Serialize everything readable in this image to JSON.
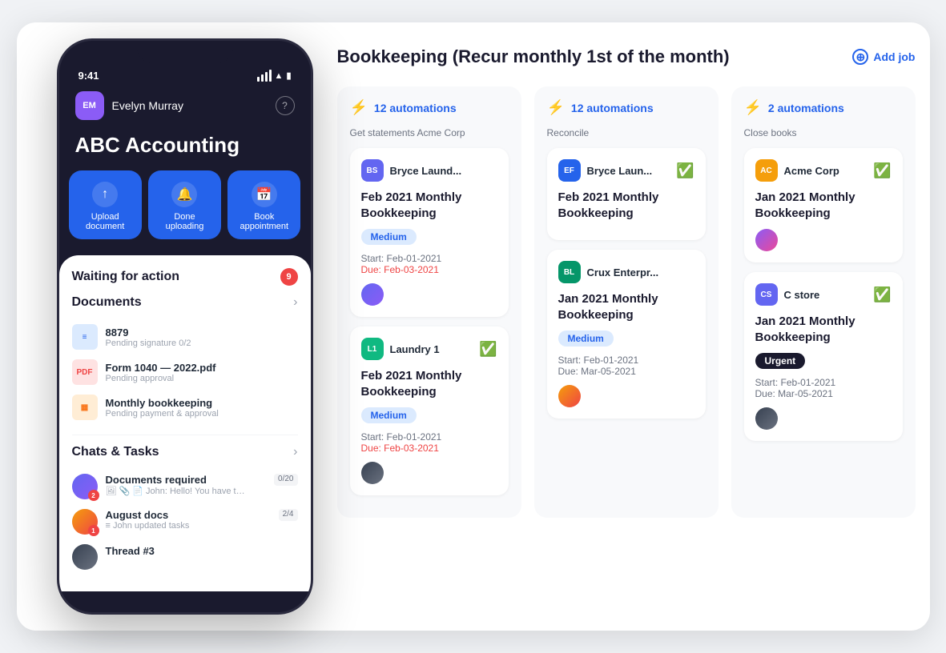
{
  "app": {
    "bg_color": "#f0f2f5"
  },
  "page": {
    "title": "Bookkeeping (Recur monthly 1st of the month)",
    "add_job_label": "Add job"
  },
  "phone": {
    "status_bar": {
      "time": "9:41"
    },
    "header": {
      "user_initials": "EM",
      "user_name": "Evelyn Murray",
      "company": "ABC Accounting"
    },
    "actions": [
      {
        "label": "Upload\ndocument",
        "icon": "↑"
      },
      {
        "label": "Done\nuploading",
        "icon": "🔔"
      },
      {
        "label": "Book\nappointment",
        "icon": "📅"
      }
    ],
    "waiting_for_action": {
      "title": "Waiting for action",
      "badge": "9"
    },
    "documents": {
      "section_title": "Documents",
      "items": [
        {
          "name": "8879",
          "sub": "Pending signature 0/2",
          "type": "doc"
        },
        {
          "name": "Form 1040 — 2022.pdf",
          "sub": "Pending approval",
          "type": "pdf"
        },
        {
          "name": "Monthly bookkeeping",
          "sub": "Pending payment & approval",
          "type": "ppt"
        }
      ]
    },
    "chats": {
      "section_title": "Chats & Tasks",
      "items": [
        {
          "title": "Documents required",
          "sub": "John: Hello! You have to read...",
          "count": "0/20",
          "badge": "2"
        },
        {
          "title": "August docs",
          "sub": "John updated tasks",
          "count": "2/4",
          "badge": "1"
        },
        {
          "title": "Thread #3",
          "sub": "",
          "count": "",
          "badge": ""
        }
      ]
    }
  },
  "columns": [
    {
      "automations": "12 automations",
      "subtitle": "Get statements Acme Corp",
      "cards": [
        {
          "client_initials": "BS",
          "client_color": "#6366f1",
          "client_name": "Bryce Laund...",
          "checked": false,
          "job_title": "Feb 2021 Monthly Bookkeeping",
          "badge": "Medium",
          "badge_type": "medium",
          "start": "Start: Feb-01-2021",
          "due": "Due: Feb-03-2021",
          "due_type": "red",
          "has_assignee": true
        },
        {
          "client_initials": "L1",
          "client_color": "#10b981",
          "client_name": "Laundry 1",
          "checked": true,
          "job_title": "Feb 2021 Monthly Bookkeeping",
          "badge": "Medium",
          "badge_type": "medium",
          "start": "Start: Feb-01-2021",
          "due": "Due: Feb-03-2021",
          "due_type": "red",
          "has_assignee": true
        }
      ]
    },
    {
      "automations": "12 automations",
      "subtitle": "Reconcile",
      "cards": [
        {
          "client_initials": "EF",
          "client_color": "#2563eb",
          "client_name": "Bryce Laun...",
          "checked": true,
          "job_title": "Feb 2021 Monthly Bookkeeping",
          "badge": null,
          "badge_type": null,
          "start": null,
          "due": null,
          "due_type": null,
          "has_assignee": false
        },
        {
          "client_initials": "BL",
          "client_color": "#059669",
          "client_name": "Crux Enterpr...",
          "checked": false,
          "job_title": "Jan 2021 Monthly Bookkeeping",
          "badge": "Medium",
          "badge_type": "medium",
          "start": "Start: Feb-01-2021",
          "due": "Due: Mar-05-2021",
          "due_type": "gray",
          "has_assignee": true
        }
      ]
    },
    {
      "automations": "2 automations",
      "subtitle": "Close books",
      "cards": [
        {
          "client_initials": "AC",
          "client_color": "#f59e0b",
          "client_name": "Acme Corp",
          "checked": true,
          "job_title": "Jan 2021 Monthly Bookkeeping",
          "badge": null,
          "badge_type": null,
          "start": null,
          "due": null,
          "due_type": null,
          "has_assignee": true,
          "assignee_type": "4"
        },
        {
          "client_initials": "CS",
          "client_color": "#6366f1",
          "client_name": "C store",
          "checked": true,
          "job_title": "Jan 2021 Monthly Bookkeeping",
          "badge": "Urgent",
          "badge_type": "urgent",
          "start": "Start: Feb-01-2021",
          "due": "Due: Mar-05-2021",
          "due_type": "gray",
          "has_assignee": true,
          "assignee_type": "5"
        }
      ]
    }
  ]
}
